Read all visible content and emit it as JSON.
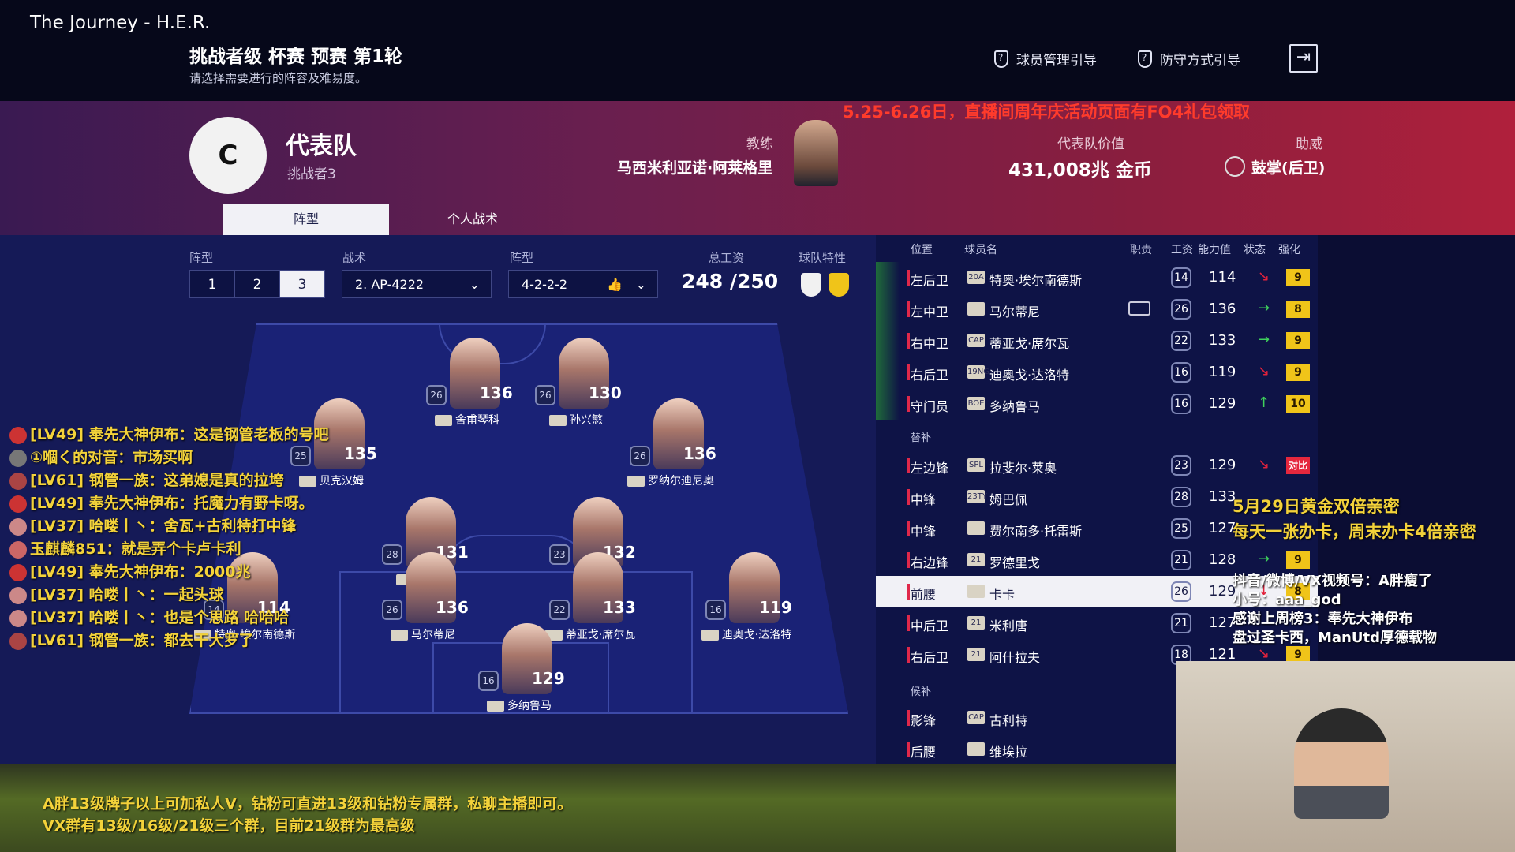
{
  "app_title": "The Journey - H.E.R.",
  "match": {
    "title": "挑战者级 杯赛 预赛 第1轮",
    "subtitle": "请选择需要进行的阵容及难易度。"
  },
  "guides": [
    "球员管理引导",
    "防守方式引导"
  ],
  "team": {
    "logo_text": "C",
    "name": "代表队",
    "sub": "挑战者3",
    "coach_label": "教练",
    "coach": "马西米利亚诺·阿莱格里",
    "value_label": "代表队价值",
    "value": "431,008兆 金币",
    "cheer_label": "助威",
    "cheer": "鼓掌(后卫)"
  },
  "promo_top": "5.25-6.26日，直播间周年庆活动页面有FO4礼包领取",
  "tabs": [
    "阵型",
    "个人战术"
  ],
  "controls": {
    "formation_label": "阵型",
    "seg": [
      "1",
      "2",
      "3"
    ],
    "tactic_label": "战术",
    "tactic": "2. AP-4222",
    "shape_label": "阵型",
    "shape": "4-2-2-2",
    "wage_label": "总工资",
    "wage": "248 /250",
    "trait_label": "球队特性"
  },
  "pitch_players": [
    {
      "name": "舍甫琴科",
      "ovr": "136",
      "wage": "26"
    },
    {
      "name": "孙兴慜",
      "ovr": "130",
      "wage": "26"
    },
    {
      "name": "贝克汉姆",
      "ovr": "135",
      "wage": "25"
    },
    {
      "name": "罗纳尔迪尼奥",
      "ovr": "136",
      "wage": "26"
    },
    {
      "name": "古利特",
      "ovr": "131",
      "wage": "28"
    },
    {
      "name": "",
      "ovr": "132",
      "wage": "23"
    },
    {
      "name": "特奥·埃尔南德斯",
      "ovr": "114",
      "wage": "14"
    },
    {
      "name": "马尔蒂尼",
      "ovr": "136",
      "wage": "26"
    },
    {
      "name": "蒂亚戈·席尔瓦",
      "ovr": "133",
      "wage": "22"
    },
    {
      "name": "迪奥戈·达洛特",
      "ovr": "119",
      "wage": "16"
    },
    {
      "name": "多纳鲁马",
      "ovr": "129",
      "wage": "16"
    }
  ],
  "list_headers": [
    "位置",
    "球员名",
    "职责",
    "工资",
    "能力值",
    "状态",
    "强化"
  ],
  "starters": [
    {
      "pos": "左后卫",
      "badge": "20A",
      "name": "特奥·埃尔南德斯",
      "wage": "14",
      "ovr": "114",
      "st": "↘",
      "enh": "9"
    },
    {
      "pos": "左中卫",
      "badge": "",
      "name": "马尔蒂尼",
      "wage": "26",
      "ovr": "136",
      "st": "→",
      "enh": "8"
    },
    {
      "pos": "右中卫",
      "badge": "CAP",
      "name": "蒂亚戈·席尔瓦",
      "wage": "22",
      "ovr": "133",
      "st": "→",
      "enh": "9"
    },
    {
      "pos": "右后卫",
      "badge": "19NG",
      "name": "迪奥戈·达洛特",
      "wage": "16",
      "ovr": "119",
      "st": "↘",
      "enh": "9"
    },
    {
      "pos": "守门员",
      "badge": "BOE",
      "name": "多纳鲁马",
      "wage": "16",
      "ovr": "129",
      "st": "↑",
      "enh": "10"
    }
  ],
  "subs_label": "替补",
  "subs": [
    {
      "pos": "左边锋",
      "badge": "SPL",
      "name": "拉斐尔·莱奥",
      "wage": "23",
      "ovr": "129",
      "st": "↘",
      "enh": "对比"
    },
    {
      "pos": "中锋",
      "badge": "23TY",
      "name": "姆巴佩",
      "wage": "28",
      "ovr": "133",
      "st": "",
      "enh": ""
    },
    {
      "pos": "中锋",
      "badge": "",
      "name": "费尔南多·托雷斯",
      "wage": "25",
      "ovr": "127",
      "st": "",
      "enh": ""
    },
    {
      "pos": "右边锋",
      "badge": "21",
      "name": "罗德里戈",
      "wage": "21",
      "ovr": "128",
      "st": "→",
      "enh": "9"
    },
    {
      "pos": "前腰",
      "badge": "",
      "name": "卡卡",
      "wage": "26",
      "ovr": "129",
      "st": "↓",
      "enh": "8"
    },
    {
      "pos": "中后卫",
      "badge": "21",
      "name": "米利唐",
      "wage": "21",
      "ovr": "127",
      "st": "",
      "enh": ""
    },
    {
      "pos": "右后卫",
      "badge": "21",
      "name": "阿什拉夫",
      "wage": "18",
      "ovr": "121",
      "st": "↘",
      "enh": "9"
    }
  ],
  "reserve_label": "候补",
  "reserves": [
    {
      "pos": "影锋",
      "badge": "CAP",
      "name": "古利特"
    },
    {
      "pos": "后腰",
      "badge": "",
      "name": "维埃拉"
    }
  ],
  "chat": [
    "[LV49] 奉先大神伊布：这是钢管老板的号吧",
    "①嗰く的对音：市场买啊",
    "[LV61] 钢管一族：这弟媳是真的拉垮",
    "[LV49] 奉先大神伊布：托魔力有野卡呀。",
    "[LV37] 哈喽丨丶：舍瓦+古利特打中锋",
    "玉麒麟851：就是弄个卡卢卡利",
    "[LV49] 奉先大神伊布：2000兆",
    "[LV37] 哈喽丨丶：一起头球",
    "[LV37] 哈喽丨丶：也是个思路 哈哈哈",
    "[LV61] 钢管一族：都去干大罗了"
  ],
  "overlay": {
    "l1": "5月29日黄金双倍亲密",
    "l2": "每天一张办卡，周末办卡4倍亲密",
    "w1": "抖音/微博/VX视频号：A胖瘦了",
    "w2": "小号：aaa_god",
    "w3": "感谢上周榜3：奉先大神伊布",
    "w4": "盘过圣卡西，ManUtd厚德载物",
    "b1": "A胖13级牌子以上可加私人V，钻粉可直进13级和钻粉专属群，私聊主播即可。",
    "b2": "VX群有13级/16级/21级三个群，目前21级群为最高级"
  }
}
